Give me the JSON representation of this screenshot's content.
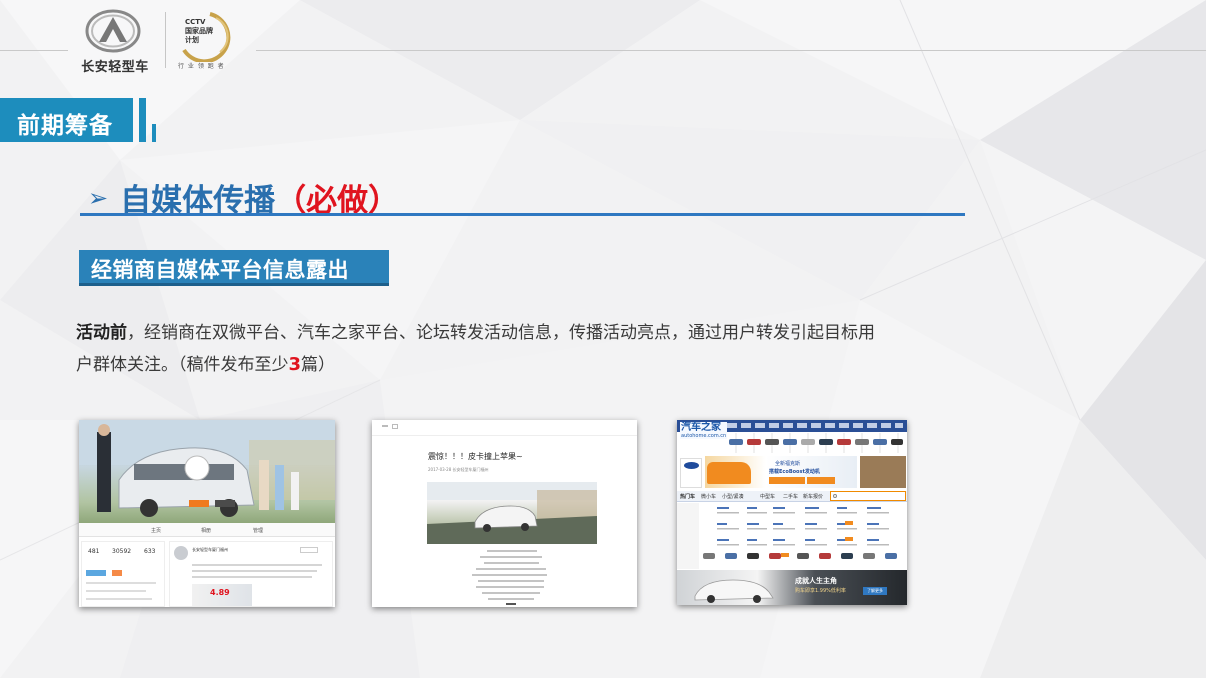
{
  "brand": {
    "name": "长安轻型车",
    "partner_lines": [
      "CCTV",
      "国家品牌",
      "计划"
    ],
    "partner_tagline": "行 业 领 跑 者"
  },
  "section": {
    "label": "前期筹备"
  },
  "title": {
    "bullet": "➢",
    "main": "自媒体传播",
    "highlight": "（必做）"
  },
  "subheading": "经销商自媒体平台信息露出",
  "body": {
    "lead": "活动前",
    "text1": "，经销商在双微平台、汽车之家平台、论坛转发活动信息，传播活动亮点，通过用户转发引起目标用",
    "text2": "户群体关注。（稿件发布至少",
    "number": "3",
    "text3": "篇）"
  },
  "screenshots": {
    "weibo": {
      "account": "长安轻型车官方微博",
      "tabs": [
        "主页",
        "相册",
        "管理"
      ],
      "stats": [
        "481",
        "30592",
        "633"
      ],
      "post_name": "长安轻型车厦门福州",
      "price_tag": "4.89"
    },
    "article": {
      "title": "震惊！！！皮卡撞上苹果~",
      "meta": "2017-03-28  长安轻型车厦门福州"
    },
    "autohome": {
      "logo": "汽车之家",
      "logo_sub": "autohome.com.cn",
      "ad_text": "全新福克斯",
      "ad_sub": "搭载EcoBoost发动机",
      "tabs": [
        "热门车",
        "微小车",
        "小型/紧凑",
        "中型车",
        "二手车",
        "新车报价"
      ],
      "banner_title": "成就人生主角",
      "banner_sub": "购车即享1.99%低利率",
      "banner_cta": "了解更多"
    }
  },
  "colors": {
    "accent_blue": "#1d8dbd",
    "title_blue": "#2a6fae",
    "highlight_red": "#e0141f"
  }
}
